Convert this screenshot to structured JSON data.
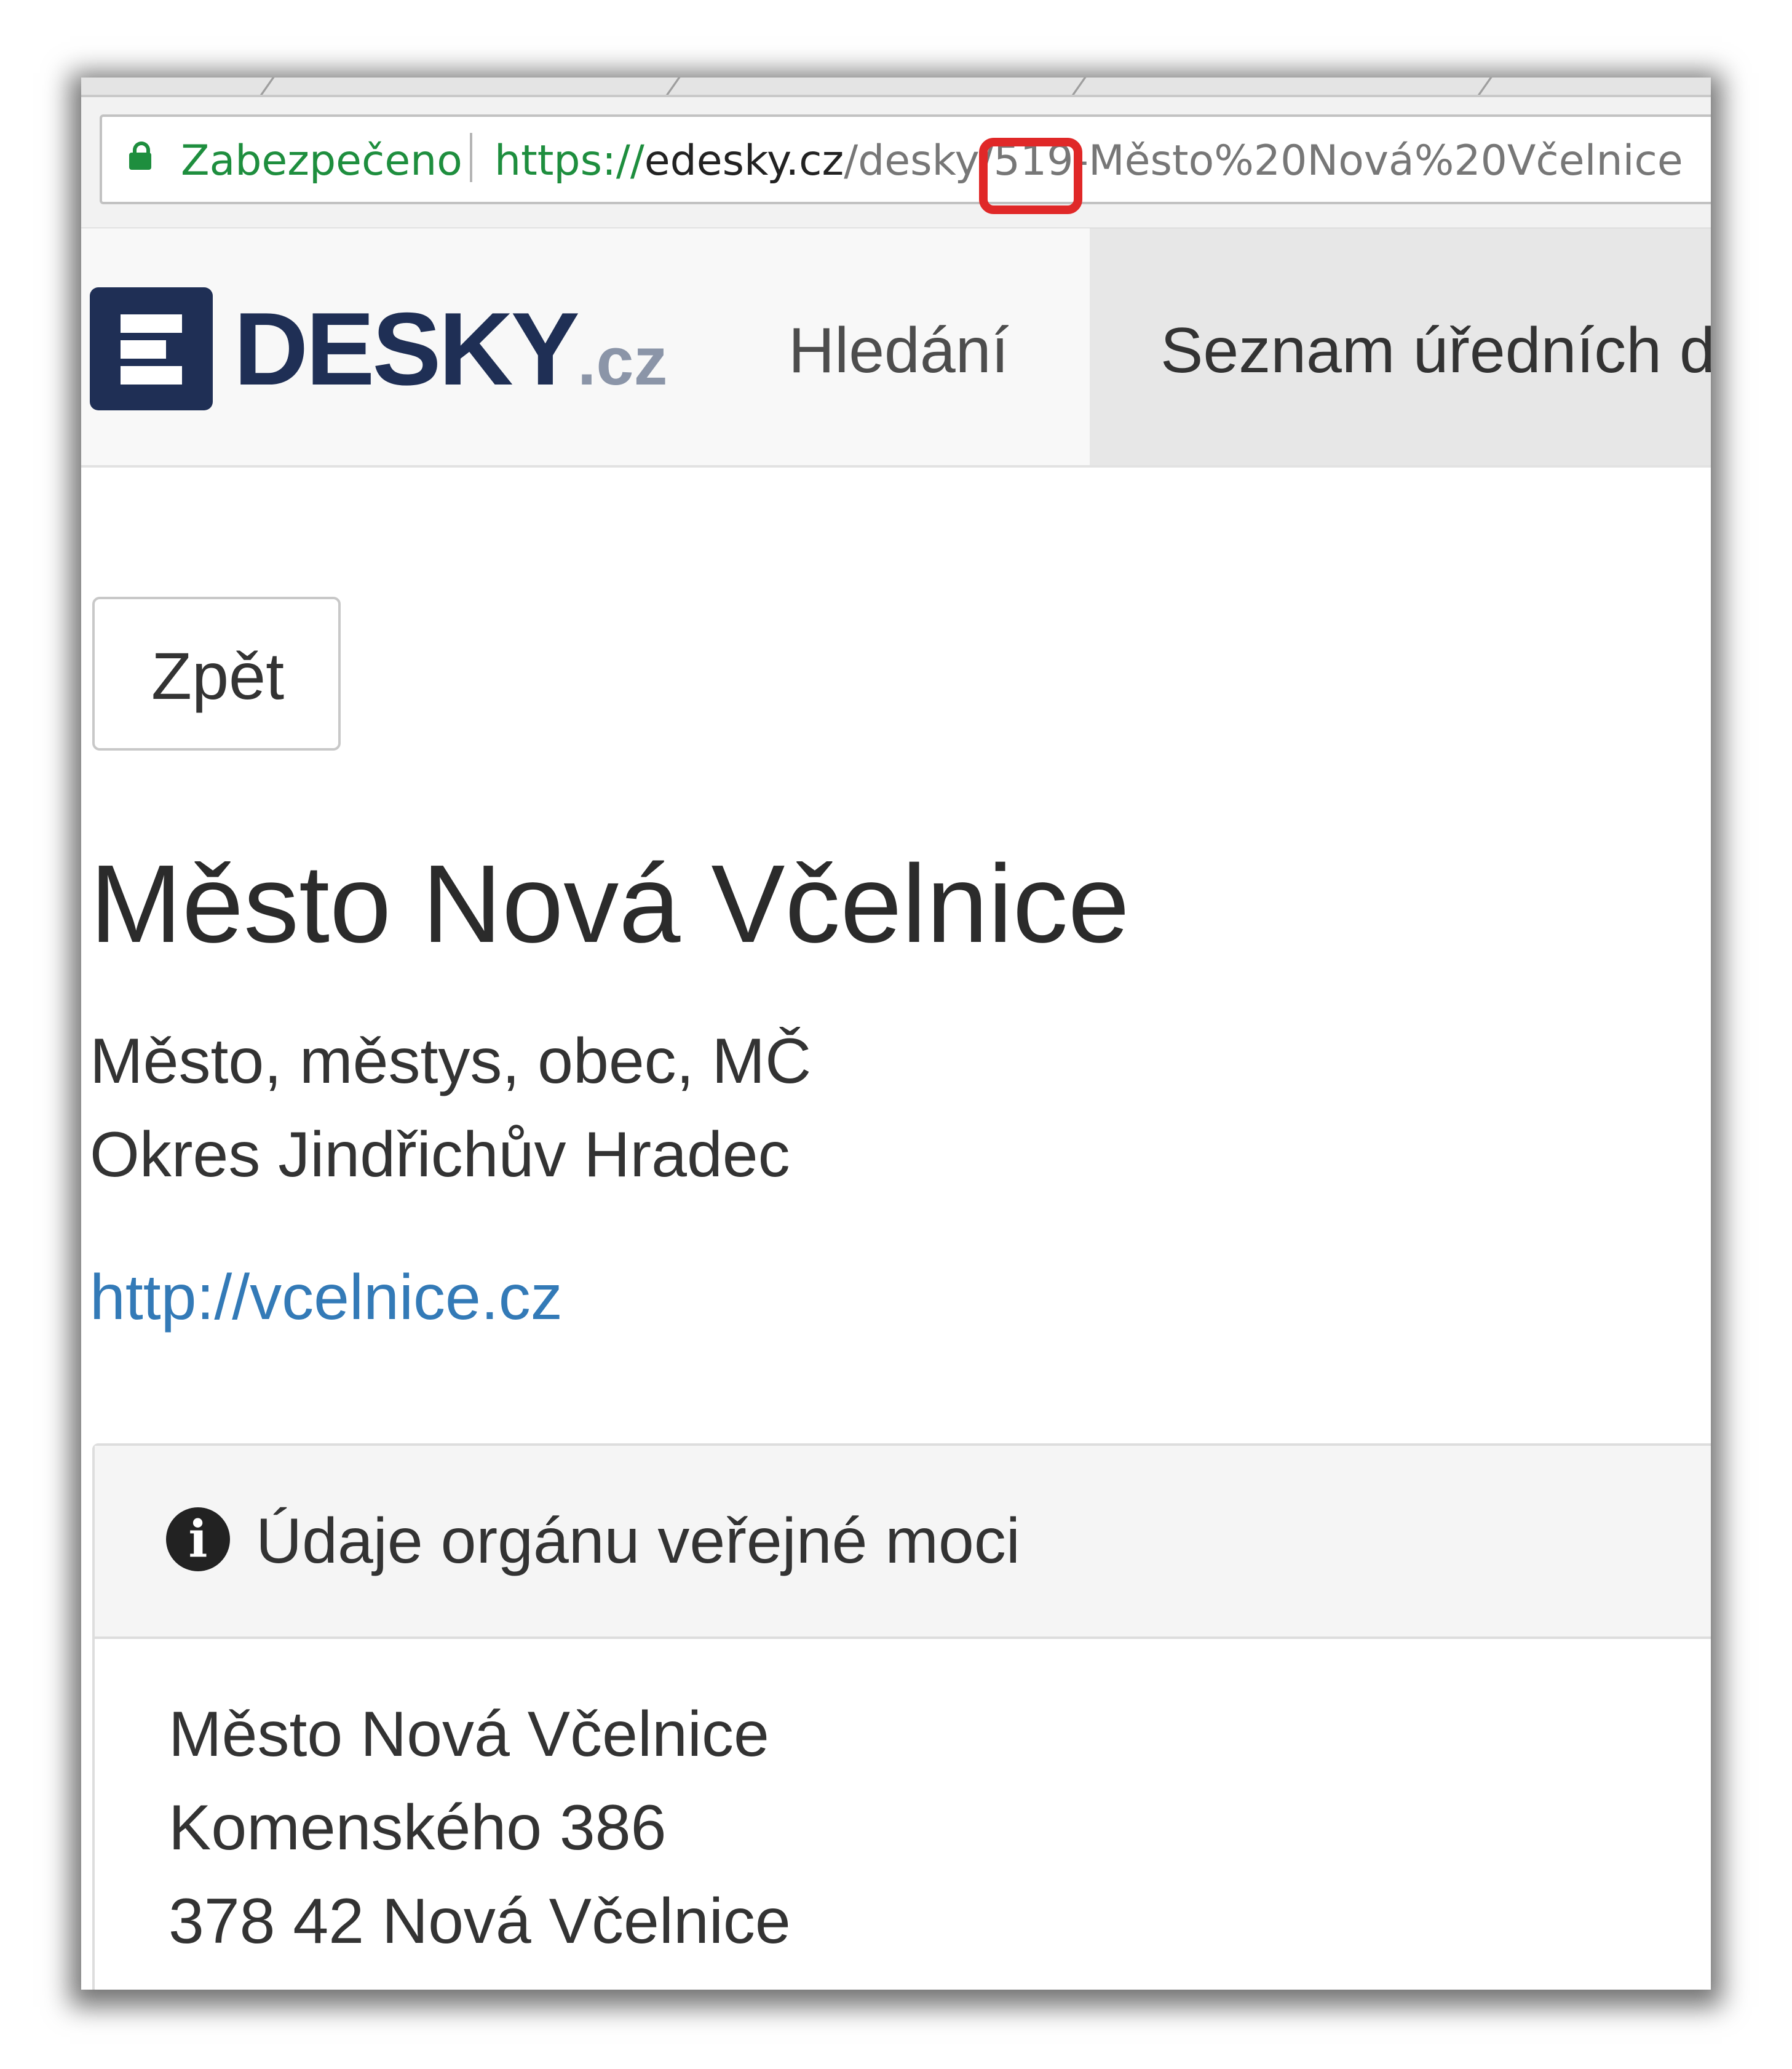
{
  "browser": {
    "secure_label": "Zabezpečeno",
    "url_scheme": "https://",
    "url_host": "edesky.cz",
    "url_path": "/desky/519-Město%20Nová%20Včelnice",
    "highlighted_segment": "519-",
    "highlight_color": "#e02828"
  },
  "site": {
    "logo_text": "DESKY",
    "logo_tld": ".cz",
    "brand_color": "#1f2f55",
    "nav": {
      "search": "Hledání",
      "boards": "Seznam úředních desek"
    }
  },
  "page": {
    "back_label": "Zpět",
    "title": "Město Nová Včelnice",
    "type": "Město, městys, obec, MČ",
    "district": "Okres Jindřichův Hradec",
    "website": "http://vcelnice.cz",
    "link_color": "#337ab7"
  },
  "panel": {
    "icon": "info-icon",
    "title": "Údaje orgánu veřejné moci",
    "address": {
      "name": "Město Nová Včelnice",
      "street": "Komenského 386",
      "city": "378 42 Nová Včelnice"
    }
  }
}
